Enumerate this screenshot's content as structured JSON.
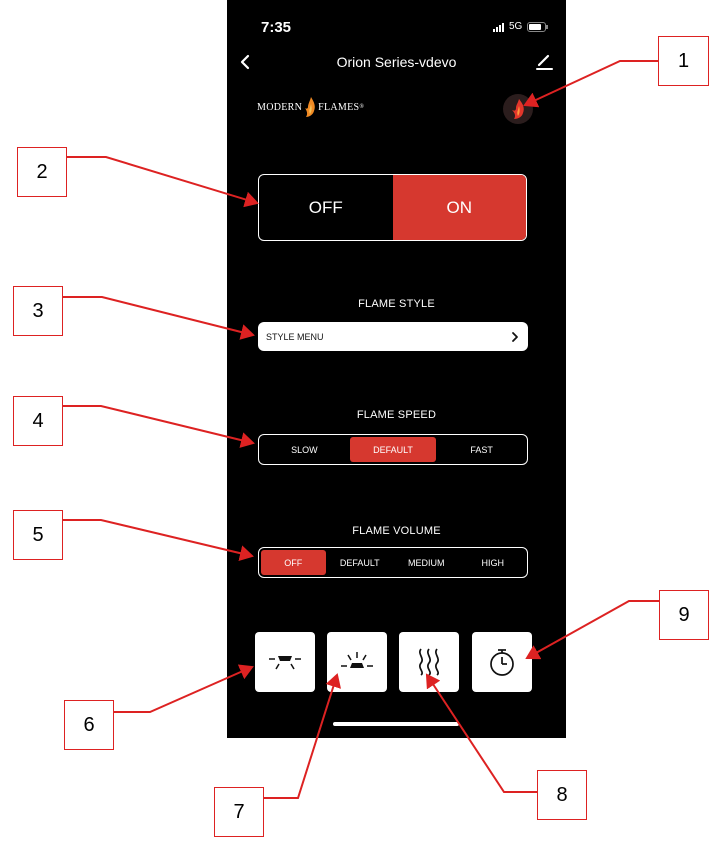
{
  "status_bar": {
    "time": "7:35",
    "network": "5G"
  },
  "nav": {
    "title": "Orion Series-vdevo"
  },
  "brand": {
    "left": "MODERN",
    "right": "FLAMES"
  },
  "power": {
    "off_label": "OFF",
    "on_label": "ON",
    "selected": "ON"
  },
  "flame_style": {
    "heading": "FLAME STYLE",
    "menu_label": "STYLE MENU"
  },
  "flame_speed": {
    "heading": "FLAME SPEED",
    "options": [
      "SLOW",
      "DEFAULT",
      "FAST"
    ],
    "selected": "DEFAULT"
  },
  "flame_volume": {
    "heading": "FLAME VOLUME",
    "options": [
      "OFF",
      "DEFAULT",
      "MEDIUM",
      "HIGH"
    ],
    "selected": "OFF"
  },
  "function_buttons": [
    "downlight-icon",
    "uplight-icon",
    "heat-icon",
    "timer-icon"
  ],
  "callouts": [
    "1",
    "2",
    "3",
    "4",
    "5",
    "6",
    "7",
    "8",
    "9"
  ],
  "colors": {
    "accent": "#d6382f",
    "callout": "#dd2222",
    "background": "#000000"
  }
}
